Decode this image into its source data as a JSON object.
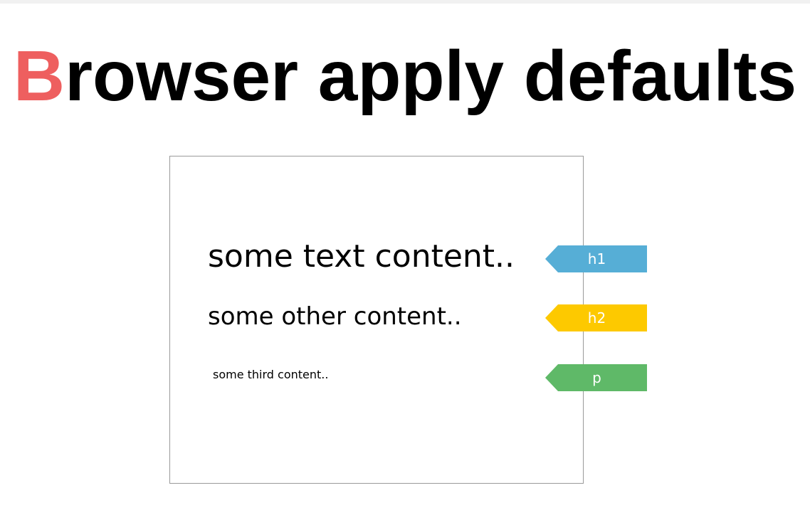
{
  "slide": {
    "title_initial": "B",
    "title_rest": "rowser apply defaults"
  },
  "demo": {
    "samples": [
      {
        "text": "some text content..",
        "tag": "h1"
      },
      {
        "text": "some other content..",
        "tag": "h2"
      },
      {
        "text": "some third content..",
        "tag": "p"
      }
    ]
  },
  "colors": {
    "title_accent": "#ee5f5f",
    "tag_h1": "#56aed6",
    "tag_h2": "#fdc900",
    "tag_p": "#5fb968"
  }
}
